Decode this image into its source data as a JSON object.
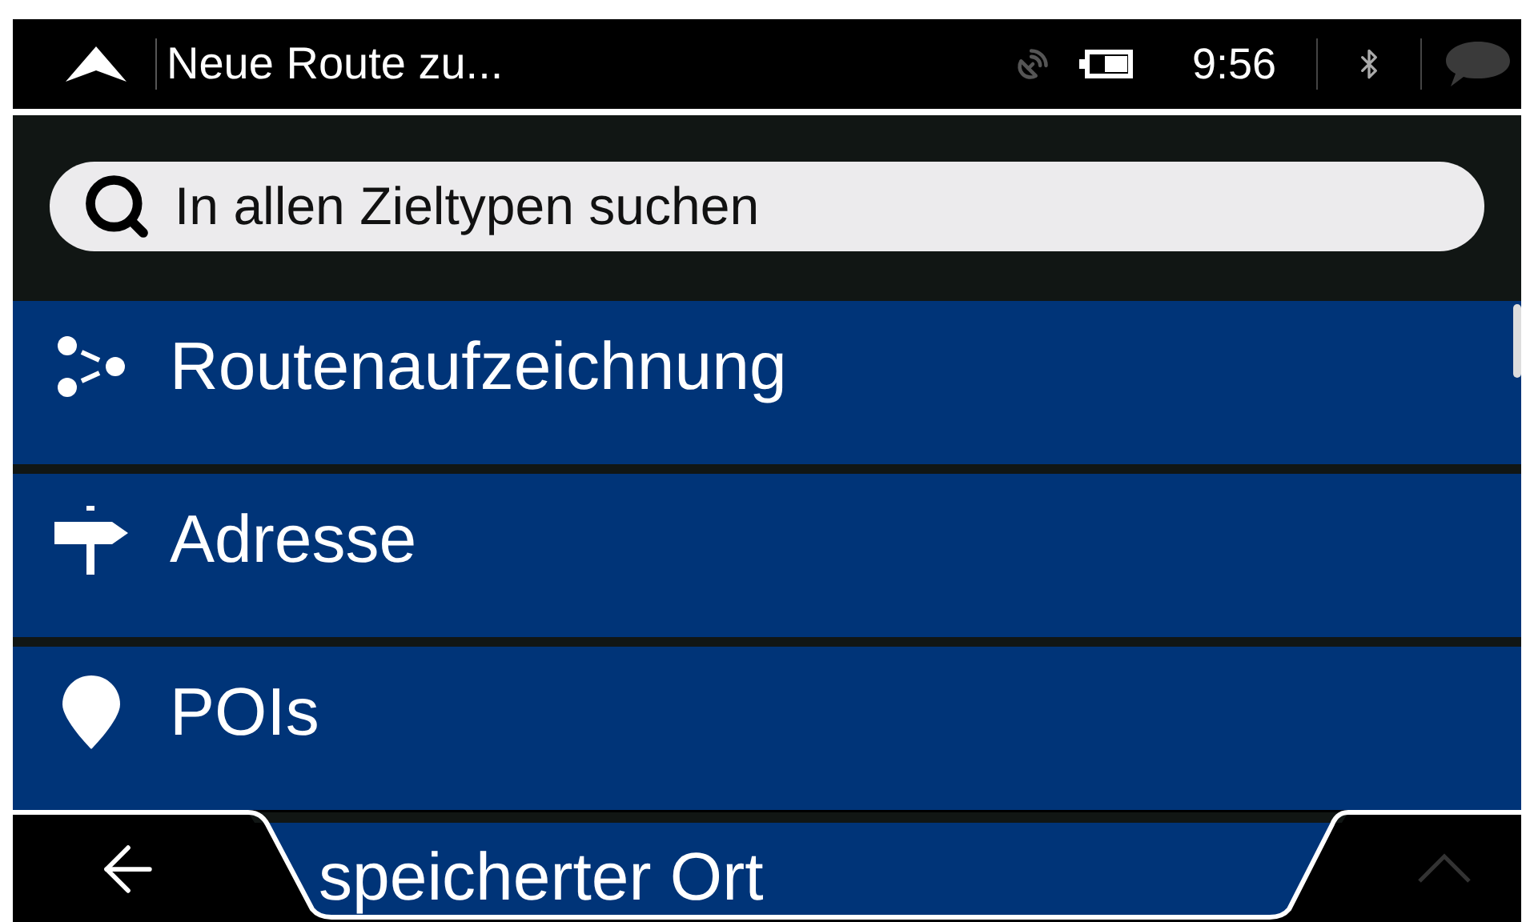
{
  "title_bar": {
    "title": "Neue Route zu...",
    "time": "9:56"
  },
  "search": {
    "placeholder": "In allen Zieltypen suchen"
  },
  "items": [
    {
      "kind": "track",
      "label": "Routenaufzeichnung"
    },
    {
      "kind": "address",
      "label": "Adresse"
    },
    {
      "kind": "poi",
      "label": "POIs"
    },
    {
      "kind": "place",
      "label": "speicherter Ort"
    }
  ],
  "bottom_bar": {
    "scroll_up": {
      "disabled": true
    }
  }
}
